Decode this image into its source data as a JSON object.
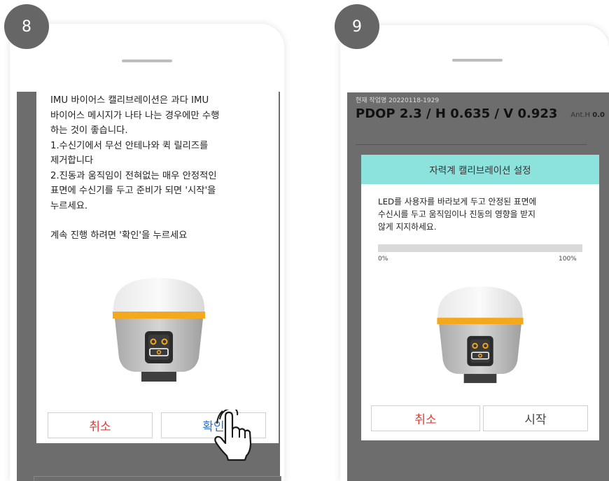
{
  "steps": [
    "8",
    "9"
  ],
  "panel8": {
    "message": [
      "IMU 바이어스 캘리브레이션은 과다 IMU",
      "바이어스 메시지가 나타 나는 경우에만 수행",
      "하는 것이 좋습니다.",
      "1.수신기에서 무선 안테나와 퀵 릴리즈를",
      "제거합니다",
      " 2.진동과 움직임이 전혀없는 매우 안정적인",
      "표면에 수신기를 두고 준비가 되면 '시작'을",
      "누르세요.",
      "",
      " 계속 진행 하려면 '확인'을 누르세요"
    ],
    "cancel_label": "취소",
    "confirm_label": "확인"
  },
  "panel9": {
    "job_name": "현재 작업명 20220118-1929",
    "pdop_line": "PDOP 2.3 / H 0.635 / V 0.923",
    "anth_label": "Ant.H",
    "anth_value": "0.0",
    "dialog_title": "자력계 캘리브레이션 설정",
    "message": [
      "LED를 사용자를 바라보게 두고 안정된 표면에",
      "수신시를 두고 움직임이나 진동의 영향을 받지",
      "않게 지지하세요."
    ],
    "progress": 0,
    "progress_min_label": "0%",
    "progress_max_label": "100%",
    "cancel_label": "취소",
    "start_label": "시작"
  },
  "colors": {
    "receiver_band": "#f4a81d",
    "dialog_header": "#8ce2dc",
    "cancel_text": "#e53935",
    "confirm_text": "#2f72c5"
  },
  "icons": [
    "gnss-receiver-illustration",
    "hand-pointer-icon"
  ]
}
